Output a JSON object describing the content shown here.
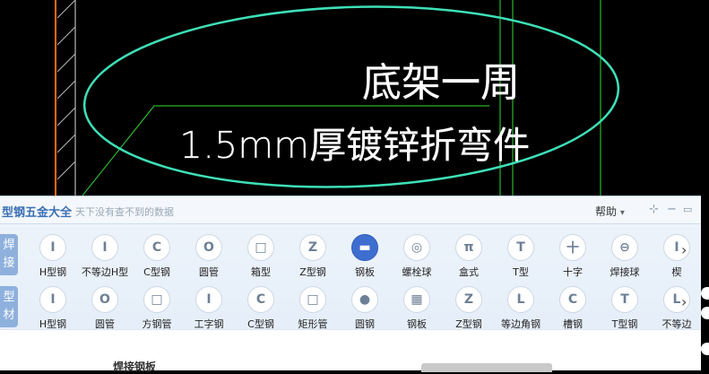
{
  "cad": {
    "line1": "底架一周",
    "line2": "1.5mm厚镀锌折弯件",
    "colors": {
      "ellipse": "#3ee0b8",
      "leader": "#33dd33",
      "orange": "#ff6a1a"
    }
  },
  "window": {
    "title": "型钢五金大全",
    "subtitle": "天下没有查不到的数据",
    "help_label": "帮助",
    "help_caret": "▾",
    "pin_glyph": "⊹",
    "min_glyph": "−",
    "max_glyph": "▭",
    "close_glyph": "✕"
  },
  "rows": [
    {
      "label": "焊接",
      "arrow": "›",
      "items": [
        {
          "label": "H型钢",
          "icon": "I"
        },
        {
          "label": "不等边H型",
          "icon": "I"
        },
        {
          "label": "C型钢",
          "icon": "C"
        },
        {
          "label": "圆管",
          "icon": "O"
        },
        {
          "label": "箱型",
          "icon": "□"
        },
        {
          "label": "Z型钢",
          "icon": "Z"
        },
        {
          "label": "钢板",
          "icon": "▬"
        },
        {
          "label": "螺栓球",
          "icon": "◎"
        },
        {
          "label": "盒式",
          "icon": "π"
        },
        {
          "label": "T型",
          "icon": "T"
        },
        {
          "label": "十字",
          "icon": "十"
        },
        {
          "label": "焊接球",
          "icon": "⊖"
        },
        {
          "label": "楔",
          "icon": "I"
        }
      ]
    },
    {
      "label": "型材",
      "arrow": "›",
      "items": [
        {
          "label": "H型钢",
          "icon": "I"
        },
        {
          "label": "圆管",
          "icon": "O"
        },
        {
          "label": "方钢管",
          "icon": "□"
        },
        {
          "label": "工字钢",
          "icon": "I"
        },
        {
          "label": "C型钢",
          "icon": "C"
        },
        {
          "label": "矩形管",
          "icon": "□"
        },
        {
          "label": "圆钢",
          "icon": "●"
        },
        {
          "label": "钢板",
          "icon": "▦"
        },
        {
          "label": "Z型钢",
          "icon": "Z"
        },
        {
          "label": "等边角钢",
          "icon": "L"
        },
        {
          "label": "槽钢",
          "icon": "C"
        },
        {
          "label": "T型钢",
          "icon": "T"
        },
        {
          "label": "不等边",
          "icon": "L"
        }
      ]
    }
  ],
  "bottom": {
    "label": "焊接钢板"
  }
}
